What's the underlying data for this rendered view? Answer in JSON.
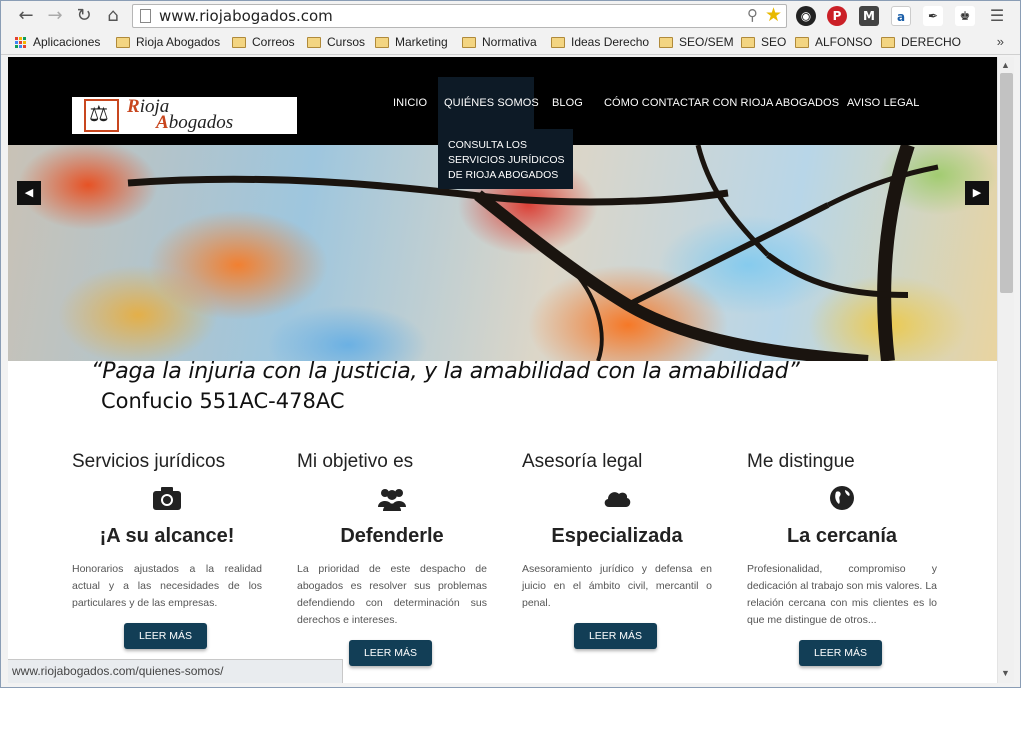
{
  "browser": {
    "url": "www.riojabogados.com",
    "status_url": "www.riojabogados.com/quienes-somos/",
    "bookmarks": [
      "Aplicaciones",
      "Rioja Abogados",
      "Correos",
      "Cursos",
      "Marketing",
      "Normativa",
      "Ideas Derecho",
      "SEO/SEM",
      "SEO",
      "ALFONSO",
      "DERECHO"
    ],
    "more_bookmarks": "»",
    "icons": {
      "back": "back-arrow-icon",
      "forward": "forward-arrow-icon",
      "reload": "reload-icon",
      "home": "home-icon",
      "star": "star-icon",
      "menu": "hamburger-menu-icon"
    }
  },
  "site": {
    "logo_word1_cap": "R",
    "logo_word1_rest": "ioja",
    "logo_word2_cap": "A",
    "logo_word2_rest": "bogados",
    "menu": [
      "INICIO",
      "QUIÉNES SOMOS",
      "BLOG",
      "CÓMO CONTACTAR CON RIOJA ABOGADOS",
      "AVISO LEGAL"
    ],
    "dropdown": "CONSULTA LOS SERVICIOS JURÍDICOS DE RIOJA ABOGADOS",
    "quote": "“Paga la injuria con la justicia, y la amabilidad con la amabilidad”",
    "author": "Confucio 551AC-478AC",
    "columns": [
      {
        "title": "Servicios jurídicos",
        "icon": "camera-icon",
        "subtitle": "¡A su alcance!",
        "text": "Honorarios ajustados a la realidad actual y a las necesidades de los particulares y de las empresas.",
        "button": "LEER MÁS"
      },
      {
        "title": "Mi objetivo es",
        "icon": "users-icon",
        "subtitle": "Defenderle",
        "text": "La prioridad de este despacho de abogados es resolver sus problemas defendiendo con determinación sus derechos e intereses.",
        "button": "LEER MÁS"
      },
      {
        "title": "Asesoría legal",
        "icon": "cloud-icon",
        "subtitle": "Especializada",
        "text": "Asesoramiento jurídico y defensa en juicio en el ámbito civil, mercantil o penal.",
        "button": "LEER MÁS"
      },
      {
        "title": "Me distingue",
        "icon": "globe-icon",
        "subtitle": "La cercanía",
        "text": "Profesionalidad, compromiso y dedicación al trabajo son mis valores. La relación cercana con mis clientes es lo que me distingue de otros...",
        "button": "LEER MÁS"
      }
    ]
  },
  "colors": {
    "header_bg": "#000000",
    "menu_active_bg": "#0d1a26",
    "button_bg": "#123e56",
    "logo_accent": "#c8461e"
  }
}
